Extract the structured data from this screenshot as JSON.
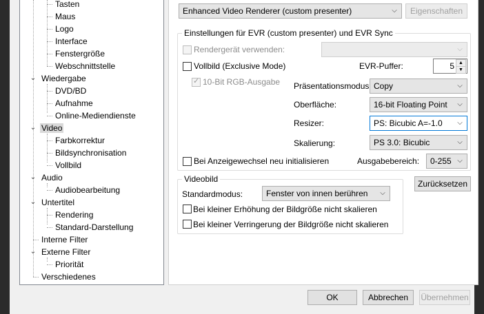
{
  "tree": {
    "items": [
      {
        "label": "Tasten",
        "level": 2
      },
      {
        "label": "Maus",
        "level": 2
      },
      {
        "label": "Logo",
        "level": 2
      },
      {
        "label": "Interface",
        "level": 2
      },
      {
        "label": "Fenstergröße",
        "level": 2
      },
      {
        "label": "Webschnittstelle",
        "level": 2
      },
      {
        "label": "Wiedergabe",
        "level": 1,
        "expanded": true
      },
      {
        "label": "DVD/BD",
        "level": 2
      },
      {
        "label": "Aufnahme",
        "level": 2
      },
      {
        "label": "Online-Mediendienste",
        "level": 2
      },
      {
        "label": "Video",
        "level": 1,
        "expanded": true,
        "selected": true
      },
      {
        "label": "Farbkorrektur",
        "level": 2
      },
      {
        "label": "Bildsynchronisation",
        "level": 2
      },
      {
        "label": "Vollbild",
        "level": 2
      },
      {
        "label": "Audio",
        "level": 1,
        "expanded": true
      },
      {
        "label": "Audiobearbeitung",
        "level": 2
      },
      {
        "label": "Untertitel",
        "level": 1,
        "expanded": true
      },
      {
        "label": "Rendering",
        "level": 2
      },
      {
        "label": "Standard-Darstellung",
        "level": 2
      },
      {
        "label": "Interne Filter",
        "level": 1
      },
      {
        "label": "Externe Filter",
        "level": 1,
        "expanded": true
      },
      {
        "label": "Priorität",
        "level": 2
      },
      {
        "label": "Verschiedenes",
        "level": 1
      }
    ]
  },
  "renderer": {
    "selected": "Enhanced Video Renderer (custom presenter)",
    "properties_button": "Eigenschaften"
  },
  "evr": {
    "group_title": "Einstellungen für EVR (custom presenter) und EVR Sync",
    "render_device_label": "Rendergerät verwenden:",
    "fullscreen_label": "Vollbild (Exclusive Mode)",
    "rgb10_label": "10-Bit RGB-Ausgabe",
    "buffer_label": "EVR-Puffer:",
    "buffer_value": "5",
    "presentation_label": "Präsentationsmodus:",
    "presentation_value": "Copy",
    "surface_label": "Oberfläche:",
    "surface_value": "16-bit Floating Point",
    "resizer_label": "Resizer:",
    "resizer_value": "PS: Bicubic A=-1.0",
    "scaling_label": "Skalierung:",
    "scaling_value": "PS 3.0: Bicubic",
    "reinit_label": "Bei Anzeigewechsel neu initialisieren",
    "output_range_label": "Ausgabebereich:",
    "output_range_value": "0-255"
  },
  "reset_button": "Zurücksetzen",
  "videobild": {
    "group_title": "Videobild",
    "default_mode_label": "Standardmodus:",
    "default_mode_value": "Fenster von innen berühren",
    "no_upscale_label": "Bei kleiner Erhöhung der Bildgröße nicht skalieren",
    "no_downscale_label": "Bei kleiner Verringerung der Bildgröße nicht skalieren"
  },
  "footer": {
    "ok": "OK",
    "cancel": "Abbrechen",
    "apply": "Übernehmen"
  }
}
